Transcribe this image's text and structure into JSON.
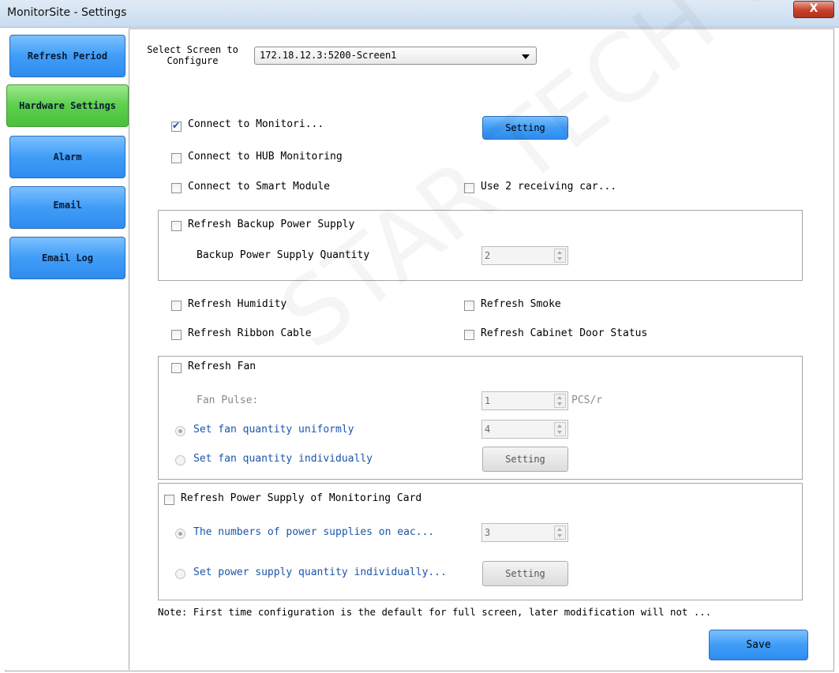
{
  "window": {
    "title": "MonitorSite - Settings",
    "close_glyph": "X"
  },
  "sidebar": {
    "items": [
      {
        "label": "Refresh Period"
      },
      {
        "label": "Hardware Settings",
        "active": true
      },
      {
        "label": "Alarm"
      },
      {
        "label": "Email"
      },
      {
        "label": "Email Log"
      }
    ]
  },
  "screen_select": {
    "label_line1": "Select Screen to",
    "label_line2": "Configure",
    "value": "172.18.12.3:5200-Screen1"
  },
  "monitoring": {
    "connect_monitoring": {
      "label": "Connect to Monitori...",
      "checked": true
    },
    "setting_button": "Setting",
    "connect_hub": {
      "label": "Connect to HUB Monitoring",
      "checked": false
    },
    "connect_smart": {
      "label": "Connect to Smart Module",
      "checked": false
    },
    "use_two_cards": {
      "label": "Use 2 receiving car...",
      "checked": false
    }
  },
  "backup_power": {
    "checkbox_label": "Refresh Backup Power Supply",
    "quantity_label": "Backup Power Supply Quantity",
    "quantity_value": "2"
  },
  "sensors": {
    "humidity": "Refresh Humidity",
    "smoke": "Refresh Smoke",
    "ribbon": "Refresh Ribbon Cable",
    "cabinet_door": "Refresh Cabinet Door Status"
  },
  "fan": {
    "checkbox_label": "Refresh Fan",
    "pulse_label": "Fan Pulse:",
    "pulse_value": "1",
    "pulse_unit": "PCS/r",
    "uniform_label": "Set fan quantity uniformly",
    "uniform_value": "4",
    "individual_label": "Set fan quantity individually",
    "setting_button": "Setting"
  },
  "power_card": {
    "checkbox_label": "Refresh Power Supply of Monitoring Card",
    "numbers_label": "The numbers of power supplies on eac...",
    "numbers_value": "3",
    "individual_label": "Set power supply quantity individually...",
    "setting_button": "Setting"
  },
  "note": "Note: First time configuration is the default for full screen, later modification will not ...",
  "save_button": "Save",
  "watermark": "STAR TECH CO.,LTD."
}
